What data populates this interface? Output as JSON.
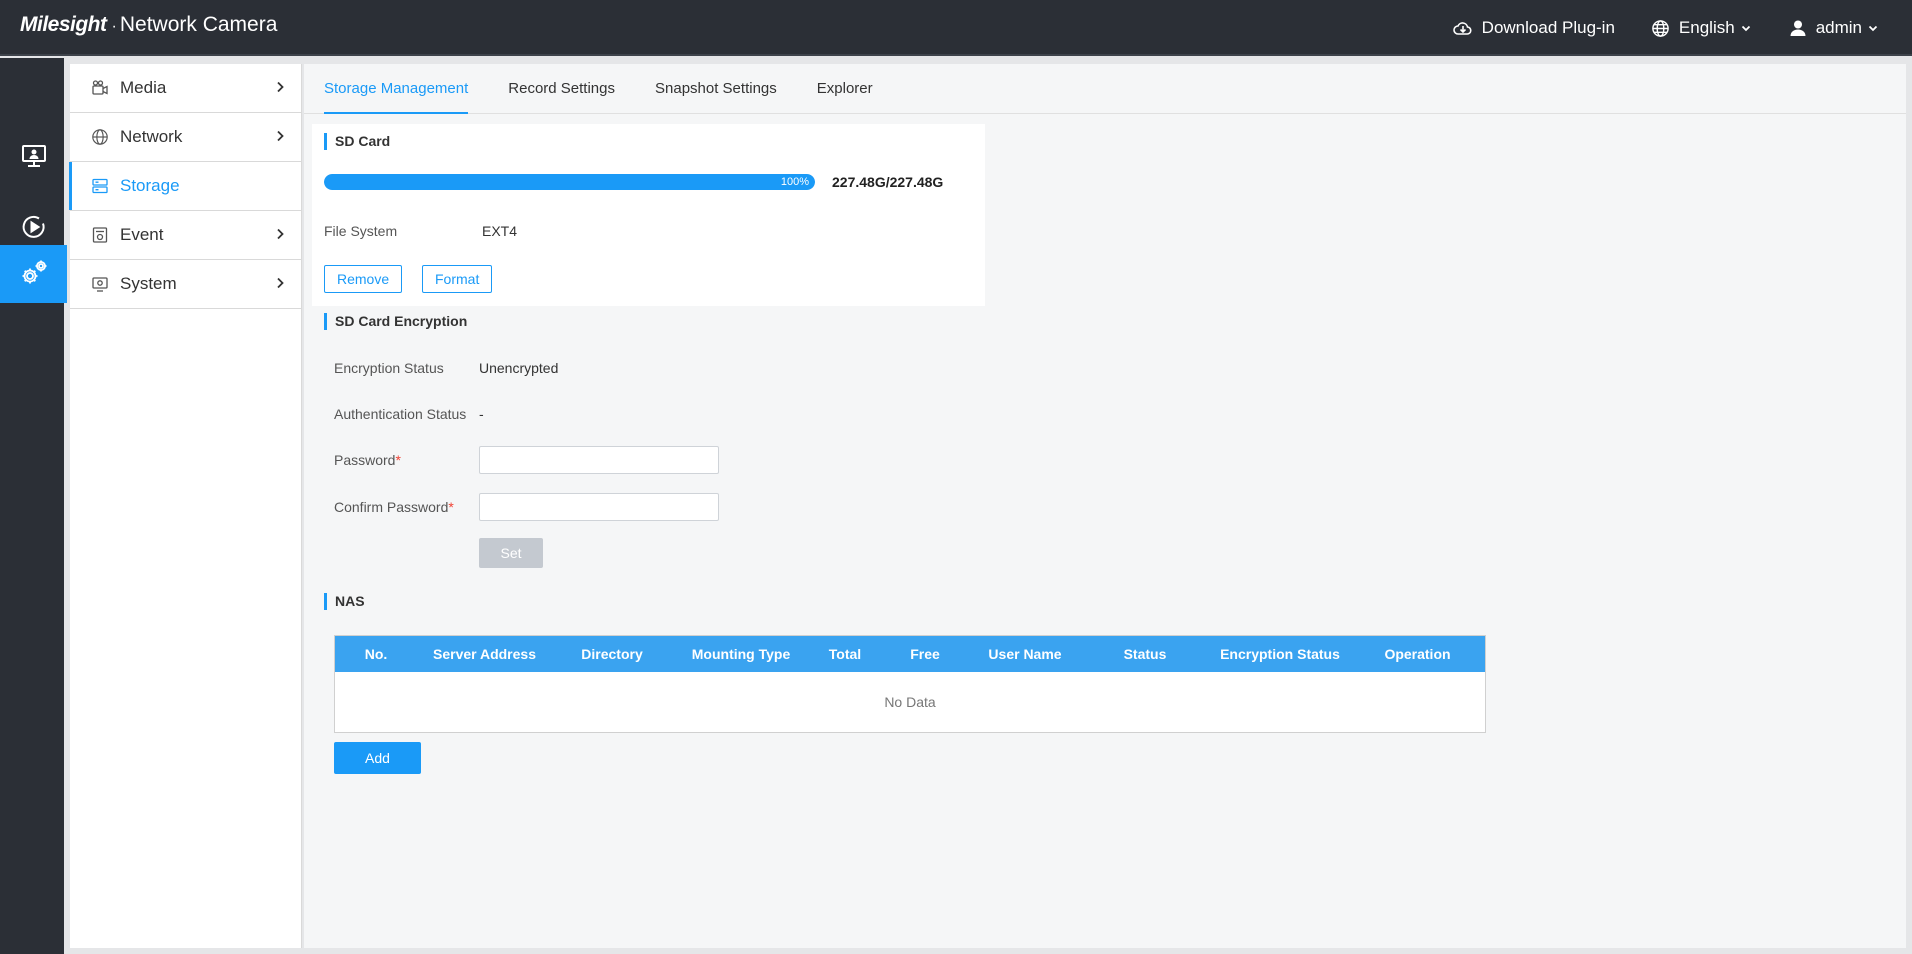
{
  "header": {
    "brand_logo": "Milesight",
    "brand_product": "Network Camera",
    "download_label": "Download Plug-in",
    "language_label": "English",
    "user_label": "admin"
  },
  "rail": {
    "items": [
      {
        "icon": "live-view-icon"
      },
      {
        "icon": "playback-icon"
      },
      {
        "icon": "settings-gear-icon",
        "active": true
      }
    ]
  },
  "sidebar": {
    "items": [
      {
        "label": "Media",
        "icon": "media-camera-icon"
      },
      {
        "label": "Network",
        "icon": "globe-icon"
      },
      {
        "label": "Storage",
        "icon": "storage-icon",
        "active": true
      },
      {
        "label": "Event",
        "icon": "event-icon"
      },
      {
        "label": "System",
        "icon": "system-icon"
      }
    ]
  },
  "tabs": [
    {
      "label": "Storage Management",
      "active": true
    },
    {
      "label": "Record Settings"
    },
    {
      "label": "Snapshot Settings"
    },
    {
      "label": "Explorer"
    }
  ],
  "sd_card": {
    "title": "SD Card",
    "usage_percent": 100,
    "usage_percent_label": "100%",
    "capacity": "227.48G/227.48G",
    "file_system_label": "File System",
    "file_system_value": "EXT4",
    "remove_label": "Remove",
    "format_label": "Format"
  },
  "encryption": {
    "title": "SD Card Encryption",
    "status_label": "Encryption Status",
    "status_value": "Unencrypted",
    "auth_label": "Authentication Status",
    "auth_value": "-",
    "password_label": "Password",
    "password_value": "",
    "confirm_label": "Confirm Password",
    "confirm_value": "",
    "required_mark": "*",
    "set_label": "Set"
  },
  "nas": {
    "title": "NAS",
    "columns": [
      "No.",
      "Server Address",
      "Directory",
      "Mounting Type",
      "Total",
      "Free",
      "User Name",
      "Status",
      "Encryption Status",
      "Operation"
    ],
    "empty_text": "No Data",
    "add_label": "Add"
  },
  "colors": {
    "accent": "#1a9af7",
    "topbar": "#2b2f36",
    "table_header": "#3aa3f0",
    "required": "#f04134"
  }
}
